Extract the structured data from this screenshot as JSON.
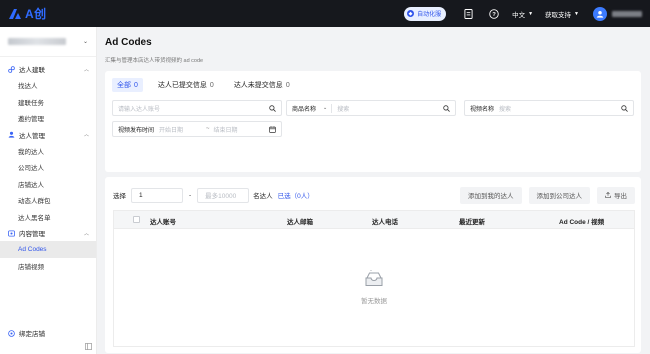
{
  "topbar": {
    "logo_text": "A创",
    "auto_label": "自动化服",
    "lang_label": "中文",
    "support_label": "获取支持",
    "icons": [
      "doc-icon",
      "help-icon",
      "user-icon"
    ]
  },
  "sidebar": {
    "groups": [
      {
        "label": "达人建联",
        "icon": "link-icon",
        "items": [
          "找达人",
          "建联任务",
          "邀约管理"
        ]
      },
      {
        "label": "达人管理",
        "icon": "user-icon",
        "items": [
          "我的达人",
          "公司达人",
          "店铺达人",
          "动态人群包",
          "达人黑名单"
        ]
      },
      {
        "label": "内容管理",
        "icon": "content-icon",
        "items": [
          "Ad Codes",
          "店铺视频"
        ]
      }
    ],
    "active_item": "Ad Codes",
    "bind_store_label": "绑定店铺"
  },
  "main": {
    "title": "Ad Codes",
    "subtitle": "汇集与管理本店达人带货视频的 ad code",
    "tabs": [
      {
        "label": "全部",
        "count": "0"
      },
      {
        "label": "达人已提交信息",
        "count": "0"
      },
      {
        "label": "达人未提交信息",
        "count": "0"
      }
    ],
    "filters": {
      "creator_placeholder": "请输入达人账号",
      "product_label": "商品名称",
      "product_placeholder": "搜索",
      "video_label": "视频名称",
      "video_placeholder": "搜索",
      "publish_label": "视频发布时间",
      "start_placeholder": "开始日期",
      "end_placeholder": "结束日期",
      "range_sep": "~"
    },
    "toolbar": {
      "select_label": "选择",
      "select_value": "1",
      "dash": "-",
      "max_placeholder": "最多10000",
      "unit_label": "名达人",
      "selected_label": "已选（0人）",
      "btn_add_mine": "添加到我的达人",
      "btn_add_company": "添加到公司达人",
      "btn_export": "导出"
    },
    "table": {
      "columns": [
        "达人账号",
        "达人邮箱",
        "达人电话",
        "最近更新",
        "Ad Code / 视频"
      ],
      "empty_text": "暂无数据"
    }
  },
  "colors": {
    "accent": "#2f54eb",
    "topbar": "#16181d"
  }
}
